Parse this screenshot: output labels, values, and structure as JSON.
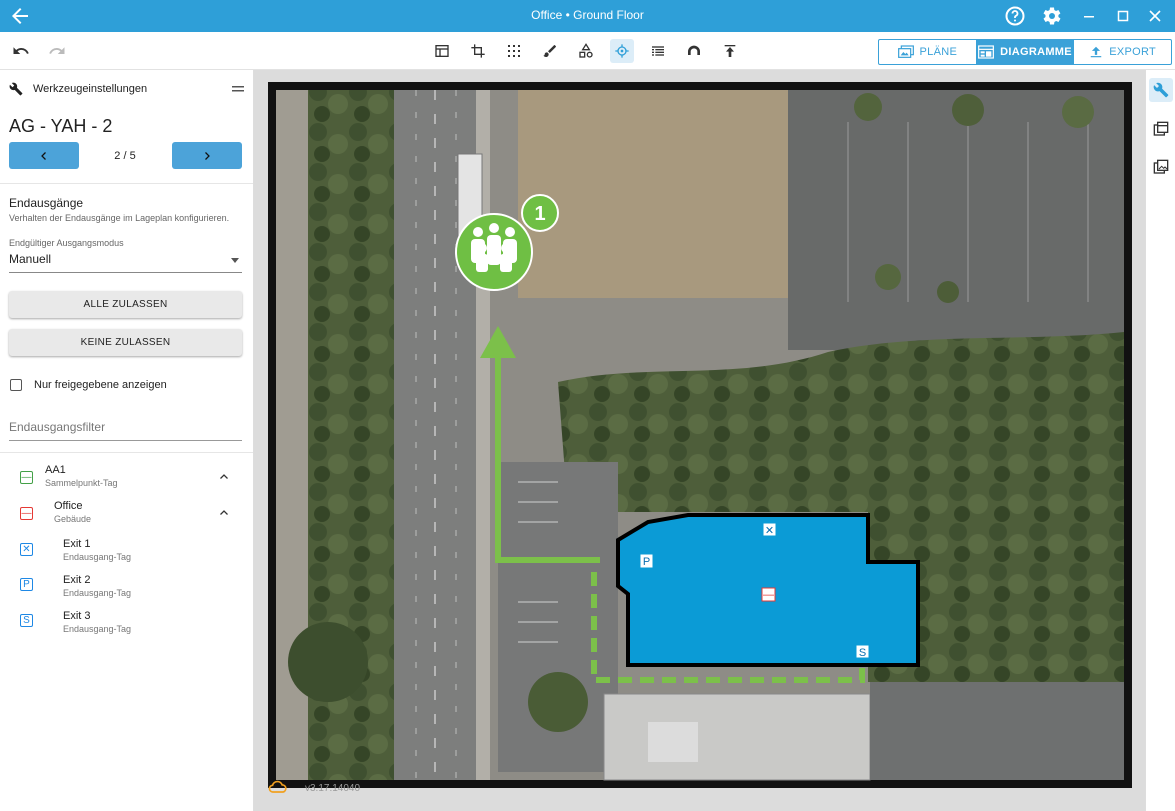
{
  "titlebar": {
    "title": "Office • Ground Floor",
    "back_icon": "arrow-left-icon",
    "help_icon": "help-circle-icon",
    "settings_icon": "gear-icon",
    "minimize_icon": "minimize-icon",
    "maximize_icon": "maximize-icon",
    "close_icon": "close-icon"
  },
  "toolbar": {
    "undo_icon": "undo-icon",
    "redo_icon": "redo-icon",
    "tools": [
      "layout-icon",
      "crop-icon",
      "select-grid-icon",
      "brush-icon",
      "shapes-icon",
      "crosshair-icon",
      "list-icon",
      "pipe-icon",
      "upload-icon"
    ],
    "active_tool": "crosshair-icon",
    "tabs": [
      {
        "label": "PLÄNE",
        "icon": "plans-icon",
        "selected": false
      },
      {
        "label": "DIAGRAMME",
        "icon": "diagrams-icon",
        "selected": true
      },
      {
        "label": "EXPORT",
        "icon": "export-icon",
        "selected": false
      }
    ]
  },
  "panel": {
    "header": "Werkzeugeinstellungen",
    "title": "AG - YAH - 2",
    "pager": "2 / 5",
    "section_title": "Endausgänge",
    "section_desc": "Verhalten der Endausgänge im Lageplan konfigurieren.",
    "mode_label": "Endgültiger Ausgangsmodus",
    "mode_value": "Manuell",
    "allow_all": "ALLE ZULASSEN",
    "allow_none": "KEINE ZULASSEN",
    "checkbox_label": "Nur freigegebene anzeigen",
    "filter_placeholder": "Endausgangsfilter",
    "tree": [
      {
        "name": "AA1",
        "sub": "Sammelpunkt-Tag",
        "glyph": "—",
        "color": "#43a047"
      },
      {
        "name": "Office",
        "sub": "Gebäude",
        "glyph": "—",
        "color": "#e53935"
      },
      {
        "name": "Exit 1",
        "sub": "Endausgang-Tag",
        "glyph": "✕",
        "color": "#1e88e5"
      },
      {
        "name": "Exit 2",
        "sub": "Endausgang-Tag",
        "glyph": "P",
        "color": "#1e88e5"
      },
      {
        "name": "Exit 3",
        "sub": "Endausgang-Tag",
        "glyph": "S",
        "color": "#1e88e5"
      }
    ]
  },
  "map": {
    "assembly_badge": "1",
    "building_color": "#0b9bd6",
    "route_color": "#7cc04a",
    "markers": {
      "exit1": "✕",
      "exit2": "P",
      "exit3": "S",
      "building": "—"
    }
  },
  "version": "v3.17.14040"
}
